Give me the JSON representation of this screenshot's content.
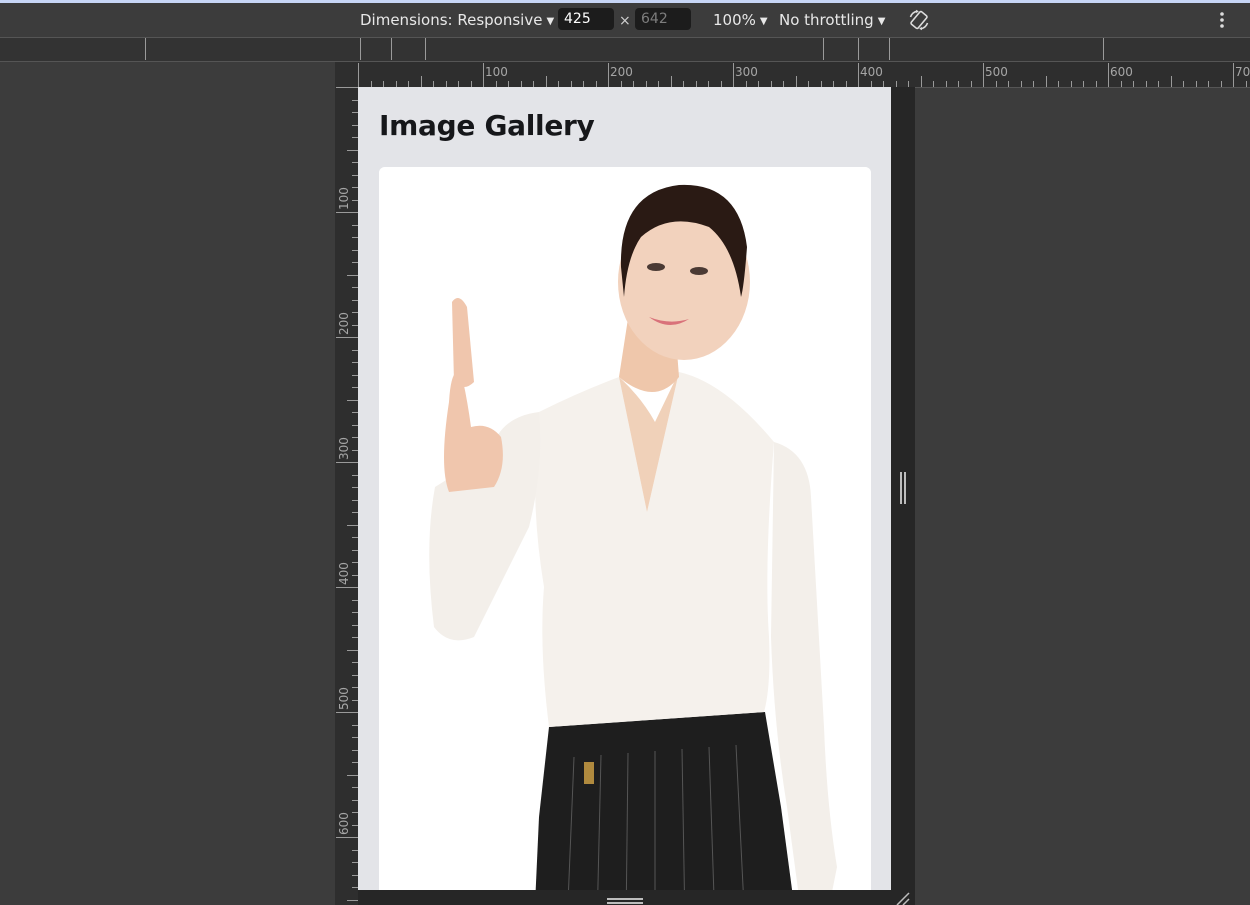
{
  "toolbar": {
    "dimensions_label": "Dimensions: Responsive",
    "width_value": "425",
    "times": "×",
    "height_placeholder": "642",
    "zoom_label": "100%",
    "throttling_label": "No throttling",
    "icons": [
      "rotate-icon",
      "more-vertical-icon"
    ]
  },
  "ruler": {
    "horizontal_labels": [
      "100",
      "200",
      "300",
      "400",
      "500",
      "600",
      "70"
    ],
    "vertical_labels": [
      "100",
      "200",
      "300",
      "400",
      "500",
      "600"
    ]
  },
  "page": {
    "title": "Image Gallery"
  },
  "colors": {
    "devtools_bg": "#3c3c3c",
    "page_bg": "#e3e4e8",
    "card_bg": "#ffffff"
  }
}
